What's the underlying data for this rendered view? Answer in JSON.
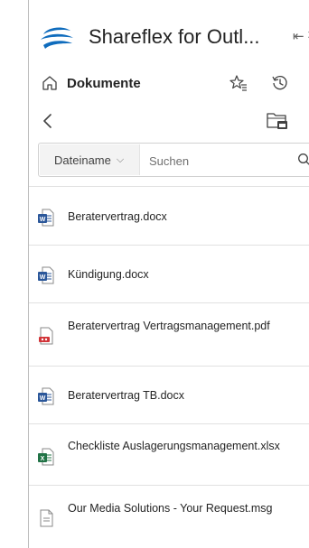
{
  "app": {
    "title": "Shareflex for Outl...",
    "pin_glyph": "⇤",
    "close_glyph": "×"
  },
  "header": {
    "title": "Dokumente"
  },
  "search": {
    "filter_label": "Dateiname",
    "placeholder": "Suchen"
  },
  "files": [
    {
      "name": "Beratervertrag.docx",
      "icon": "word-doc-icon"
    },
    {
      "name": "Kündigung.docx",
      "icon": "word-doc-icon"
    },
    {
      "name": "Beratervertrag Vertragsmanagement.pdf",
      "icon": "pdf-doc-icon"
    },
    {
      "name": "Beratervertrag TB.docx",
      "icon": "word-doc-icon"
    },
    {
      "name": "Checkliste Auslagerungsmanagement.xlsx",
      "icon": "excel-doc-icon"
    },
    {
      "name": "Our Media Solutions - Your Request.msg",
      "icon": "generic-doc-icon"
    }
  ],
  "colors": {
    "word": "#2b579a",
    "excel": "#217346",
    "pdf": "#d13438",
    "logo": "#0f6cbd"
  }
}
